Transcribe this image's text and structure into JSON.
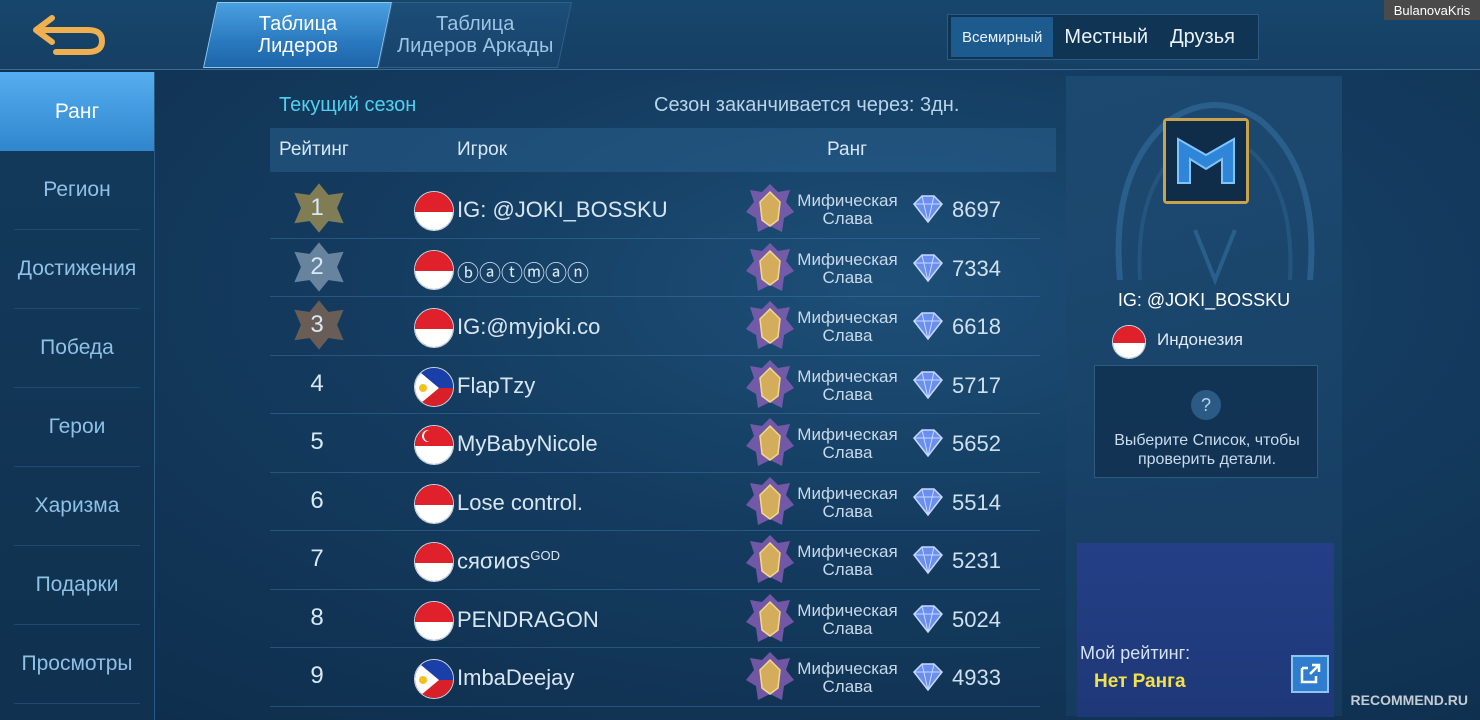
{
  "header": {
    "tabs": [
      {
        "label": "Таблица\nЛидеров",
        "line1": "Таблица",
        "line2": "Лидеров"
      },
      {
        "label": "Таблица\nЛидеров Аркады",
        "line1": "Таблица",
        "line2": "Лидеров Аркады"
      }
    ],
    "scope": [
      "Всемирный",
      "Местный",
      "Друзья"
    ],
    "watermark_user": "BulanovaKris"
  },
  "sidebar": {
    "items": [
      "Ранг",
      "Регион",
      "Достижения",
      "Победа",
      "Герои",
      "Харизма",
      "Подарки",
      "Просмотры"
    ]
  },
  "main": {
    "season_title": "Текущий сезон",
    "season_end": "Сезон заканчивается через: 3дн.",
    "columns": {
      "rating": "Рейтинг",
      "player": "Игрок",
      "rank": "Ранг"
    },
    "rows": [
      {
        "pos": "1",
        "flag": "indonesia",
        "player": "IG: @JOKI_BOSSKU",
        "sup": "",
        "rank_line1": "Мифическая",
        "rank_line2": "Слава",
        "stars": "8697"
      },
      {
        "pos": "2",
        "flag": "indonesia",
        "player": "ⓑⓐⓣⓜⓐⓝ",
        "sup": "",
        "rank_line1": "Мифическая",
        "rank_line2": "Слава",
        "stars": "7334"
      },
      {
        "pos": "3",
        "flag": "indonesia",
        "player": "IG:@myjoki.co",
        "sup": "",
        "rank_line1": "Мифическая",
        "rank_line2": "Слава",
        "stars": "6618"
      },
      {
        "pos": "4",
        "flag": "philippines",
        "player": "FlapTzy",
        "sup": "",
        "rank_line1": "Мифическая",
        "rank_line2": "Слава",
        "stars": "5717"
      },
      {
        "pos": "5",
        "flag": "singapore",
        "player": "MyBabyNicole",
        "sup": "",
        "rank_line1": "Мифическая",
        "rank_line2": "Слава",
        "stars": "5652"
      },
      {
        "pos": "6",
        "flag": "indonesia",
        "player": "Lose control.",
        "sup": "",
        "rank_line1": "Мифическая",
        "rank_line2": "Слава",
        "stars": "5514"
      },
      {
        "pos": "7",
        "flag": "indonesia",
        "player": "cяσиσѕ",
        "sup": "GOD",
        "rank_line1": "Мифическая",
        "rank_line2": "Слава",
        "stars": "5231"
      },
      {
        "pos": "8",
        "flag": "indonesia",
        "player": "PENDRAGON",
        "sup": "",
        "rank_line1": "Мифическая",
        "rank_line2": "Слава",
        "stars": "5024"
      },
      {
        "pos": "9",
        "flag": "philippines",
        "player": "ImbaDeejay",
        "sup": "",
        "rank_line1": "Мифическая",
        "rank_line2": "Слава",
        "stars": "4933"
      }
    ]
  },
  "right_panel": {
    "player_name": "IG: @JOKI_BOSSKU",
    "country": "Индонезия",
    "help_icon": "?",
    "help_text_line1": "Выберите Список, чтобы",
    "help_text_line2": "проверить детали.",
    "my_rating_label": "Мой рейтинг:",
    "my_rating_value": "Нет Ранга"
  },
  "watermark": "RECOMMEND.RU",
  "colors": {
    "accent_cyan": "#4fd0f0",
    "active_tab": "#2a79c0",
    "gold_text": "#f4e04a",
    "avatar_border": "#c9a24a"
  }
}
